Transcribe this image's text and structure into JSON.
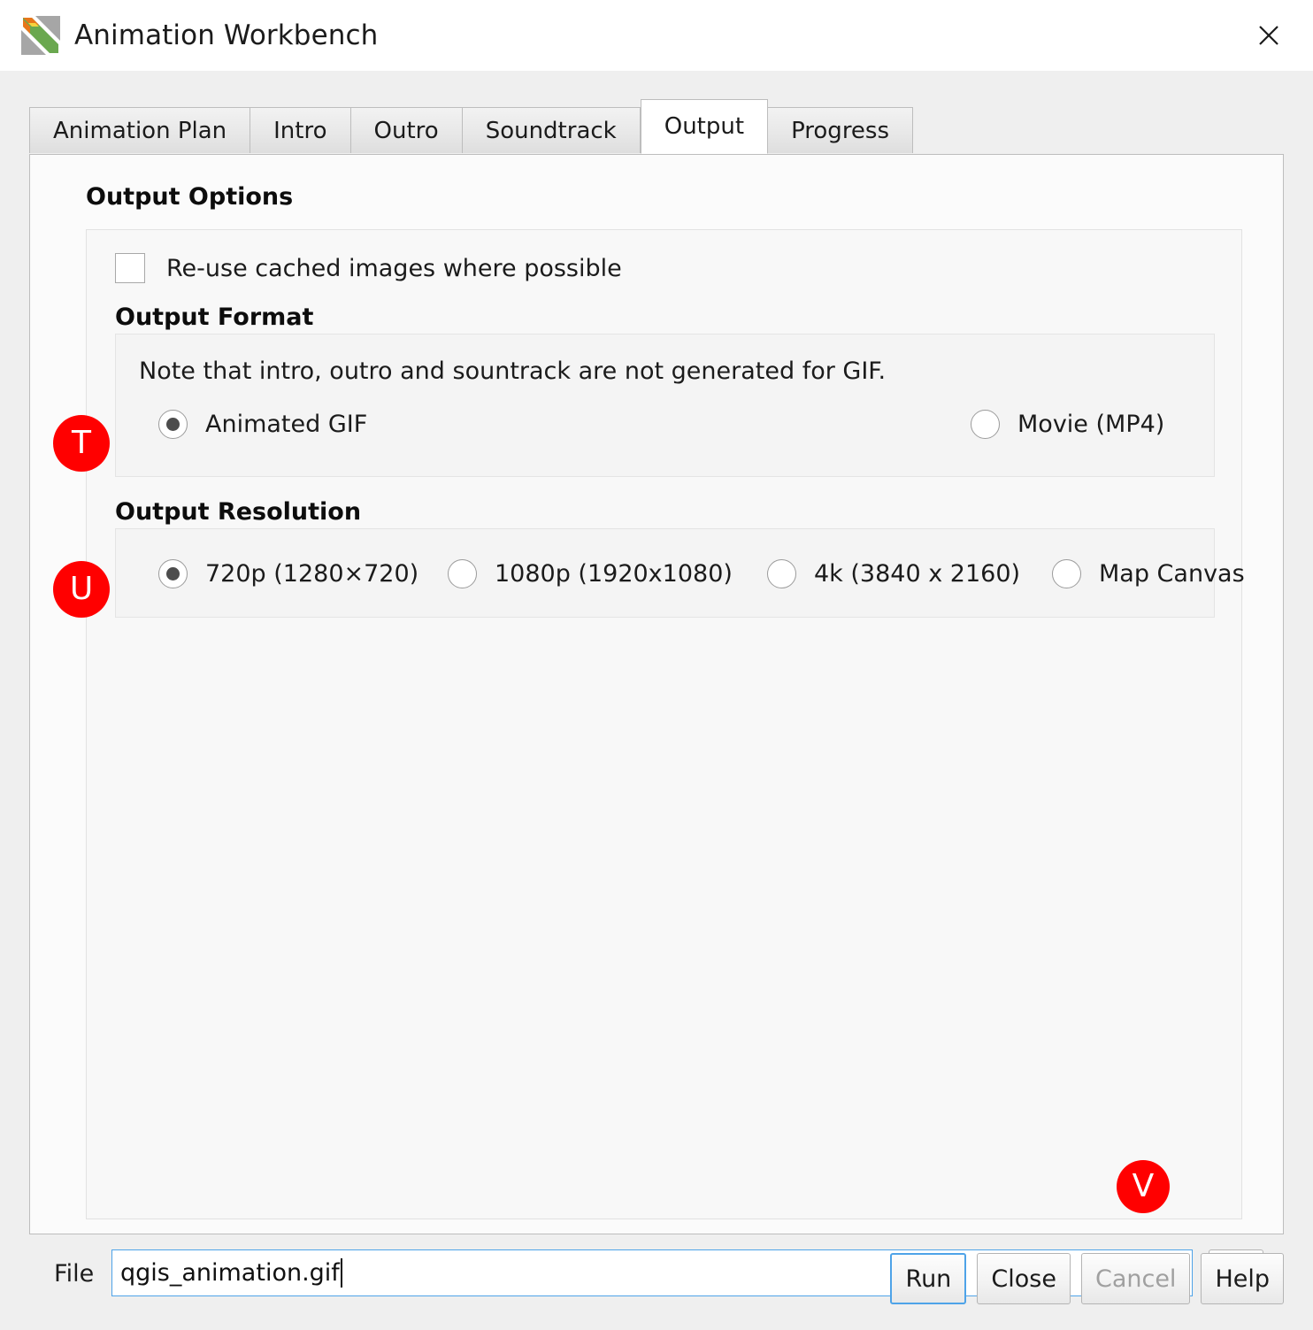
{
  "window": {
    "title": "Animation Workbench",
    "icon": "animation-workbench-logo",
    "close_label": "✕"
  },
  "tabs": [
    {
      "label": "Animation Plan",
      "active": false
    },
    {
      "label": "Intro",
      "active": false
    },
    {
      "label": "Outro",
      "active": false
    },
    {
      "label": "Soundtrack",
      "active": false
    },
    {
      "label": "Output",
      "active": true
    },
    {
      "label": "Progress",
      "active": false
    }
  ],
  "output_options": {
    "heading": "Output Options",
    "cache_checkbox": {
      "label": "Re-use cached images where possible",
      "checked": false
    },
    "output_format": {
      "heading": "Output Format",
      "note": "Note that intro, outro and sountrack are not generated for GIF.",
      "options": [
        {
          "label": "Animated GIF",
          "selected": true
        },
        {
          "label": "Movie (MP4)",
          "selected": false
        }
      ]
    },
    "output_resolution": {
      "heading": "Output Resolution",
      "options": [
        {
          "label": "720p (1280×720)",
          "selected": true
        },
        {
          "label": "1080p (1920x1080)",
          "selected": false
        },
        {
          "label": "4k (3840 x 2160)",
          "selected": false
        },
        {
          "label": "Map Canvas",
          "selected": false
        }
      ]
    }
  },
  "file_row": {
    "label": "File",
    "value": "qgis_animation.gif",
    "browse_label": "..."
  },
  "buttons": [
    {
      "label": "Run",
      "state": "default"
    },
    {
      "label": "Close",
      "state": "normal"
    },
    {
      "label": "Cancel",
      "state": "disabled"
    },
    {
      "label": "Help",
      "state": "normal"
    }
  ],
  "annotations": [
    {
      "letter": "T",
      "target": "animated-gif-radio"
    },
    {
      "letter": "U",
      "target": "720p-radio"
    },
    {
      "letter": "V",
      "target": "file-input"
    }
  ],
  "colors": {
    "annotation_badge": "#ff0000",
    "focus_border": "#4ea3e8",
    "window_background": "#efefef",
    "panel_background": "#fbfbfb"
  }
}
